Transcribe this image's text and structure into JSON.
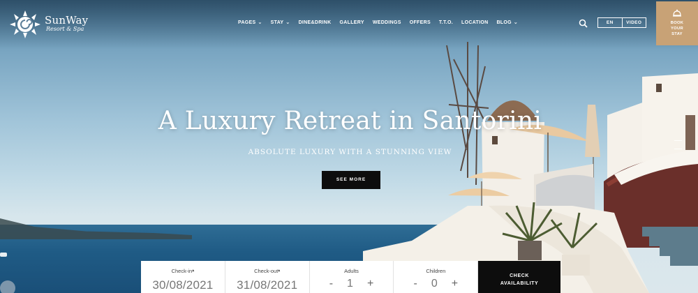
{
  "brand": {
    "name": "SunWay",
    "tagline": "Resort & Spa"
  },
  "nav": {
    "items": [
      {
        "label": "PAGES",
        "has_dropdown": true
      },
      {
        "label": "STAY",
        "has_dropdown": true
      },
      {
        "label": "DINE&DRINK",
        "has_dropdown": false
      },
      {
        "label": "GALLERY",
        "has_dropdown": false
      },
      {
        "label": "WEDDINGS",
        "has_dropdown": false
      },
      {
        "label": "OFFERS",
        "has_dropdown": false
      },
      {
        "label": "T.T.O.",
        "has_dropdown": false
      },
      {
        "label": "LOCATION",
        "has_dropdown": false
      },
      {
        "label": "BLOG",
        "has_dropdown": true
      }
    ],
    "search_icon": "search-icon",
    "lang_label": "EN",
    "video_label": "VIDEO",
    "book": {
      "line1": "BOOK",
      "line2": "YOUR",
      "line3": "STAY",
      "icon": "bell-icon"
    }
  },
  "hero": {
    "title": "A Luxury Retreat in Santorini",
    "subtitle": "ABSOLUTE LUXURY WITH A STUNNING VIEW",
    "cta": "SEE MORE"
  },
  "booking": {
    "check_in": {
      "label": "Check-in",
      "value": "30/08/2021"
    },
    "check_out": {
      "label": "Check-out",
      "value": "31/08/2021"
    },
    "adults": {
      "label": "Adults",
      "value": "1",
      "minus": "-",
      "plus": "+"
    },
    "children": {
      "label": "Children",
      "value": "0",
      "minus": "-",
      "plus": "+"
    },
    "submit": {
      "line1": "CHECK",
      "line2": "AVAILABILITY"
    }
  },
  "colors": {
    "accent": "#c8a276",
    "button_dark": "#0d0d0d",
    "white": "#ffffff"
  }
}
